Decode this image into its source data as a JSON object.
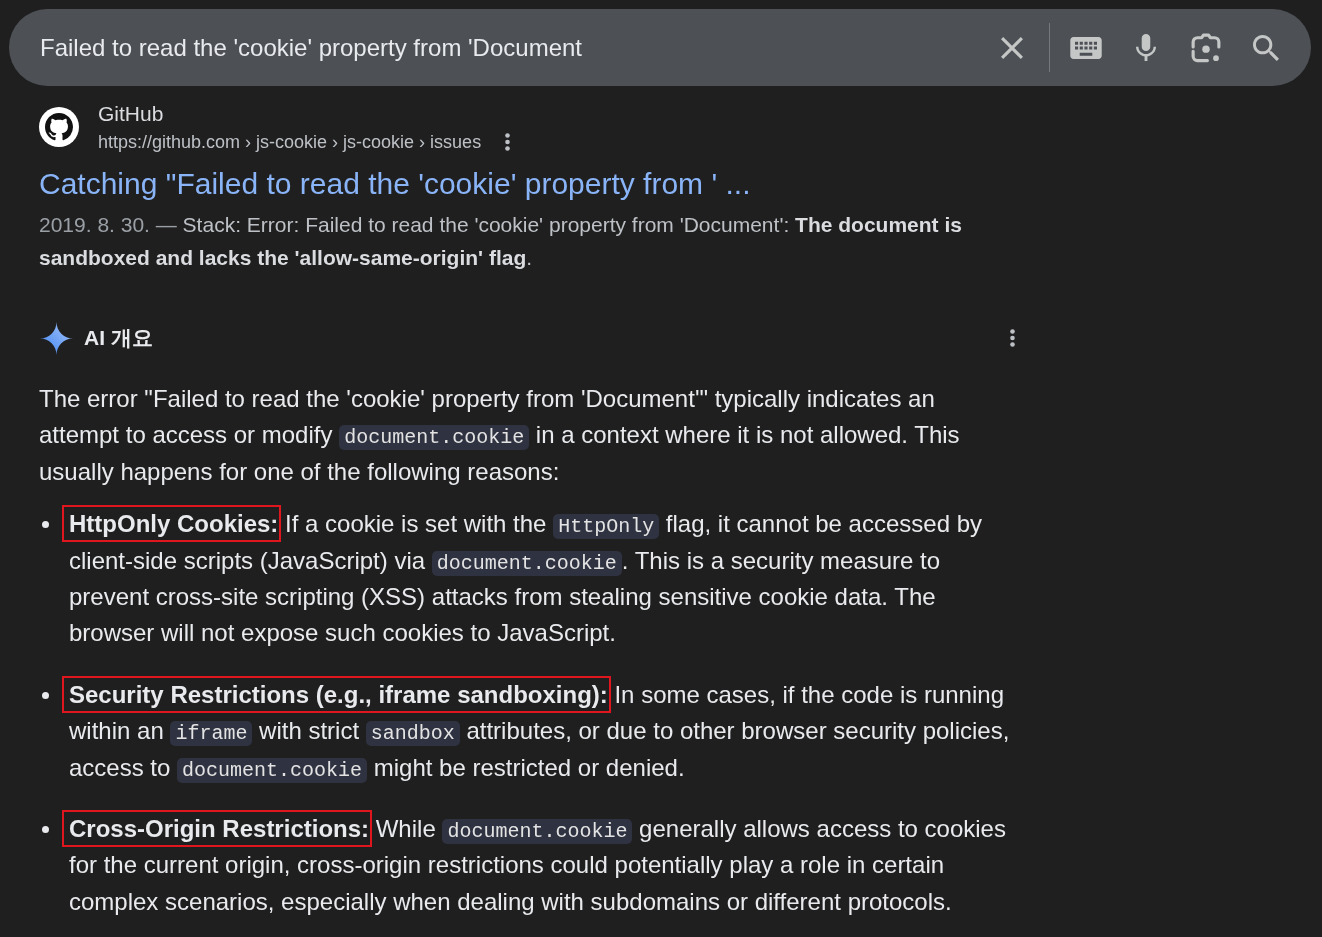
{
  "search_bar": {
    "query": "Failed to read the 'cookie' property from 'Document"
  },
  "result": {
    "site_name": "GitHub",
    "breadcrumb": "https://github.com › js-cookie › js-cookie › issues",
    "title": "Catching \"Failed to read the 'cookie' property from ' ...",
    "date": "2019. 8. 30. —",
    "snippet": "Stack: Error: Failed to read the 'cookie' property from 'Document': **The document is sandboxed and lacks the 'allow-same-origin' flag**."
  },
  "ai_overview": {
    "heading": "AI 개요",
    "intro": [
      {
        "kind": "text",
        "text": "The error \"Failed to read the 'cookie' property from 'Document'\" typically indicates an attempt to access or modify "
      },
      {
        "kind": "code",
        "text": "document.cookie"
      },
      {
        "kind": "text",
        "text": " in a context where it is not allowed. This usually happens for one of the following reasons:"
      }
    ],
    "items": [
      {
        "segments": [
          {
            "kind": "term",
            "text": "HttpOnly Cookies:",
            "boxed": true
          },
          {
            "kind": "text",
            "text": " If a cookie is set with the "
          },
          {
            "kind": "code",
            "text": "HttpOnly"
          },
          {
            "kind": "text",
            "text": " flag, it cannot be accessed by client-side scripts (JavaScript) via "
          },
          {
            "kind": "code",
            "text": "document.cookie"
          },
          {
            "kind": "text",
            "text": ". This is a security measure to prevent cross-site scripting (XSS) attacks from stealing sensitive cookie data. The browser will not expose such cookies to JavaScript."
          }
        ]
      },
      {
        "segments": [
          {
            "kind": "term",
            "text": "Security Restrictions (e.g., iframe sandboxing):",
            "boxed": true
          },
          {
            "kind": "text",
            "text": " In some cases, if the code is running within an "
          },
          {
            "kind": "code",
            "text": "iframe"
          },
          {
            "kind": "text",
            "text": " with strict "
          },
          {
            "kind": "code",
            "text": "sandbox"
          },
          {
            "kind": "text",
            "text": " attributes, or due to other browser security policies, access to "
          },
          {
            "kind": "code",
            "text": "document.cookie"
          },
          {
            "kind": "text",
            "text": " might be restricted or denied."
          }
        ]
      },
      {
        "segments": [
          {
            "kind": "term",
            "text": "Cross-Origin Restrictions:",
            "boxed": true
          },
          {
            "kind": "text",
            "text": " While "
          },
          {
            "kind": "code",
            "text": "document.cookie"
          },
          {
            "kind": "text",
            "text": " generally allows access to cookies for the current origin, cross-origin restrictions could potentially play a role in certain complex scenarios, especially when dealing with subdomains or different protocols."
          }
        ]
      }
    ]
  }
}
